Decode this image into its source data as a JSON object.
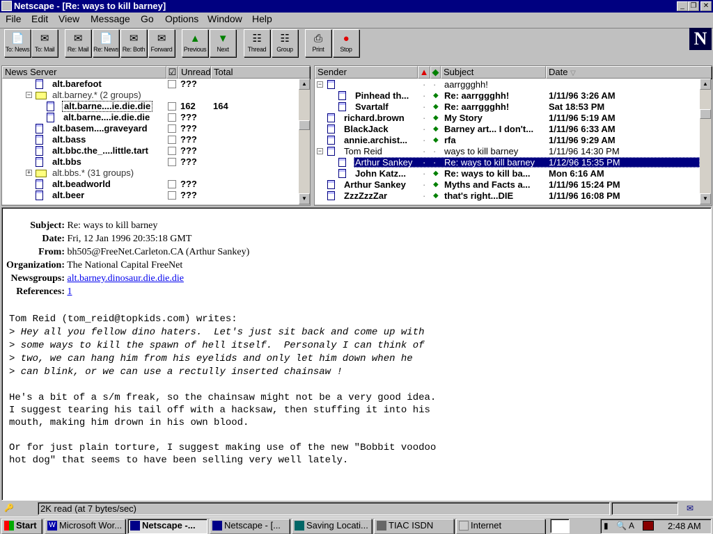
{
  "window": {
    "title": "Netscape - [Re: ways to kill barney]"
  },
  "menu": [
    "File",
    "Edit",
    "View",
    "Message",
    "Go",
    "Options",
    "Window",
    "Help"
  ],
  "toolbar": [
    {
      "label": "To: News",
      "icon": "to-news-icon"
    },
    {
      "label": "To: Mail",
      "icon": "to-mail-icon"
    },
    {
      "label": "Re: Mail",
      "icon": "reply-mail-icon"
    },
    {
      "label": "Re: News",
      "icon": "reply-news-icon"
    },
    {
      "label": "Re: Both",
      "icon": "reply-both-icon"
    },
    {
      "label": "Forward",
      "icon": "forward-icon"
    },
    {
      "label": "Previous",
      "icon": "previous-icon"
    },
    {
      "label": "Next",
      "icon": "next-icon"
    },
    {
      "label": "Thread",
      "icon": "thread-icon"
    },
    {
      "label": "Group",
      "icon": "group-icon"
    },
    {
      "label": "Print",
      "icon": "print-icon"
    },
    {
      "label": "Stop",
      "icon": "stop-icon"
    }
  ],
  "servers": {
    "columns": [
      "News Server",
      "Unread",
      "Total"
    ],
    "rows": [
      {
        "name": "alt.barefoot",
        "unread": "???",
        "total": "",
        "bold": true,
        "type": "doc",
        "indent": 1
      },
      {
        "name": "alt.barney.* (2 groups)",
        "unread": "",
        "total": "",
        "bold": false,
        "type": "folder",
        "indent": 0,
        "expander": "−"
      },
      {
        "name": "alt.barne....ie.die.die",
        "unread": "162",
        "total": "164",
        "bold": true,
        "type": "doc",
        "indent": 2,
        "selected": true
      },
      {
        "name": "alt.barne....ie.die.die",
        "unread": "???",
        "total": "",
        "bold": true,
        "type": "doc",
        "indent": 2
      },
      {
        "name": "alt.basem....graveyard",
        "unread": "???",
        "total": "",
        "bold": true,
        "type": "doc",
        "indent": 1
      },
      {
        "name": "alt.bass",
        "unread": "???",
        "total": "",
        "bold": true,
        "type": "doc",
        "indent": 1
      },
      {
        "name": "alt.bbc.the_....little.tart",
        "unread": "???",
        "total": "",
        "bold": true,
        "type": "doc",
        "indent": 1
      },
      {
        "name": "alt.bbs",
        "unread": "???",
        "total": "",
        "bold": true,
        "type": "doc",
        "indent": 1
      },
      {
        "name": "alt.bbs.* (31 groups)",
        "unread": "",
        "total": "",
        "bold": false,
        "type": "folder",
        "indent": 0,
        "expander": "+"
      },
      {
        "name": "alt.beadworld",
        "unread": "???",
        "total": "",
        "bold": true,
        "type": "doc",
        "indent": 1
      },
      {
        "name": "alt.beer",
        "unread": "???",
        "total": "",
        "bold": true,
        "type": "doc",
        "indent": 1
      }
    ]
  },
  "messages": {
    "columns": [
      "Sender",
      "Subject",
      "Date"
    ],
    "rows": [
      {
        "sender": "",
        "subject": "aarrggghh!",
        "date": "",
        "bold": false,
        "indent": 0,
        "expander": "−"
      },
      {
        "sender": "Pinhead th...",
        "subject": "Re: aarrggghh!",
        "date": "1/11/96 3:26 AM",
        "bold": true,
        "indent": 1
      },
      {
        "sender": "Svartalf",
        "subject": "Re: aarrggghh!",
        "date": "Sat 18:53 PM",
        "bold": true,
        "indent": 1
      },
      {
        "sender": "richard.brown",
        "subject": "My Story",
        "date": "1/11/96 5:19 AM",
        "bold": true,
        "indent": 0
      },
      {
        "sender": "BlackJack",
        "subject": "Barney art... I don't...",
        "date": "1/11/96 6:33 AM",
        "bold": true,
        "indent": 0
      },
      {
        "sender": "annie.archist...",
        "subject": "rfa",
        "date": "1/11/96 9:29 AM",
        "bold": true,
        "indent": 0
      },
      {
        "sender": "Tom Reid",
        "subject": "ways to kill barney",
        "date": "1/11/96 14:30 PM",
        "bold": false,
        "indent": 0,
        "expander": "−"
      },
      {
        "sender": "Arthur Sankey",
        "subject": "Re: ways to kill barney",
        "date": "1/12/96 15:35 PM",
        "bold": false,
        "indent": 1,
        "selected": true
      },
      {
        "sender": "John Katz...",
        "subject": "Re: ways to kill ba...",
        "date": "Mon 6:16 AM",
        "bold": true,
        "indent": 1
      },
      {
        "sender": "Arthur Sankey",
        "subject": "Myths and Facts a...",
        "date": "1/11/96 15:24 PM",
        "bold": true,
        "indent": 0
      },
      {
        "sender": "ZzzZzzZar",
        "subject": "that's right...DIE",
        "date": "1/11/96 16:08 PM",
        "bold": true,
        "indent": 0
      }
    ]
  },
  "message": {
    "headers": [
      {
        "key": "Subject:",
        "value": "Re: ways to kill barney"
      },
      {
        "key": "Date:",
        "value": "Fri, 12 Jan 1996 20:35:18 GMT"
      },
      {
        "key": "From:",
        "value": "bh505@FreeNet.Carleton.CA (Arthur Sankey)"
      },
      {
        "key": "Organization:",
        "value": "The National Capital FreeNet"
      },
      {
        "key": "Newsgroups:",
        "value": "alt.barney.dinosaur.die.die.die",
        "link": true
      },
      {
        "key": "References:",
        "value": "1",
        "link": true
      }
    ],
    "attribution": "Tom Reid (tom_reid@topkids.com) writes:",
    "quoted": [
      "> Hey all you fellow dino haters.  Let's just sit back and come up with",
      "> some ways to kill the spawn of hell itself.  Personaly I can think of",
      "> two, we can hang him from his eyelids and only let him down when he",
      "> can blink, or we can use a rectully inserted chainsaw !"
    ],
    "body": [
      "He's a bit of a s/m freak, so the chainsaw might not be a very good idea.",
      "I suggest tearing his tail off with a hacksaw, then stuffing it into his",
      "mouth, making him drown in his own blood.",
      "",
      "Or for just plain torture, I suggest making use of the new \"Bobbit voodoo",
      "hot dog\" that seems to have been selling very well lately."
    ]
  },
  "status": {
    "text": "2K read (at 7 bytes/sec)"
  },
  "taskbar": {
    "start": "Start",
    "tasks": [
      "Microsoft Wor...",
      "Netscape -...",
      "Netscape - [...",
      "Saving Locati...",
      "TIAC ISDN",
      "Internet"
    ],
    "clock": "2:48 AM"
  },
  "colors": {
    "title_bg": "#000080",
    "selection": "#000080",
    "link": "#0000ee"
  }
}
